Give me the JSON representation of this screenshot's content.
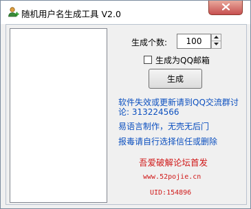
{
  "window": {
    "title": "随机用户名生成工具 V2.0",
    "close_label": "x"
  },
  "icons": {
    "app": "person-add-icon",
    "close": "close-icon",
    "spin_up": "arrow-up-icon",
    "spin_down": "arrow-down-icon"
  },
  "controls": {
    "count_label": "生成个数:",
    "count_value": "100",
    "qq_mail_checkbox": {
      "label": "生成为QQ邮箱",
      "checked": false
    },
    "generate_button": "生成"
  },
  "info": {
    "line1": "软件失效或更新请到QQ交流群讨",
    "line2": "论: 313224566",
    "line3": "易语言制作，无壳无后门",
    "line4": "报毒请自行选择信任或删除"
  },
  "credits": {
    "forum": "吾爱破解论坛首发",
    "site": "www.52pojie.cn",
    "uid": "UID:154896"
  },
  "output_list": [],
  "colors": {
    "info_blue": "#0b4fbf",
    "credit_red": "#d01818",
    "close_red": "#c75050"
  }
}
